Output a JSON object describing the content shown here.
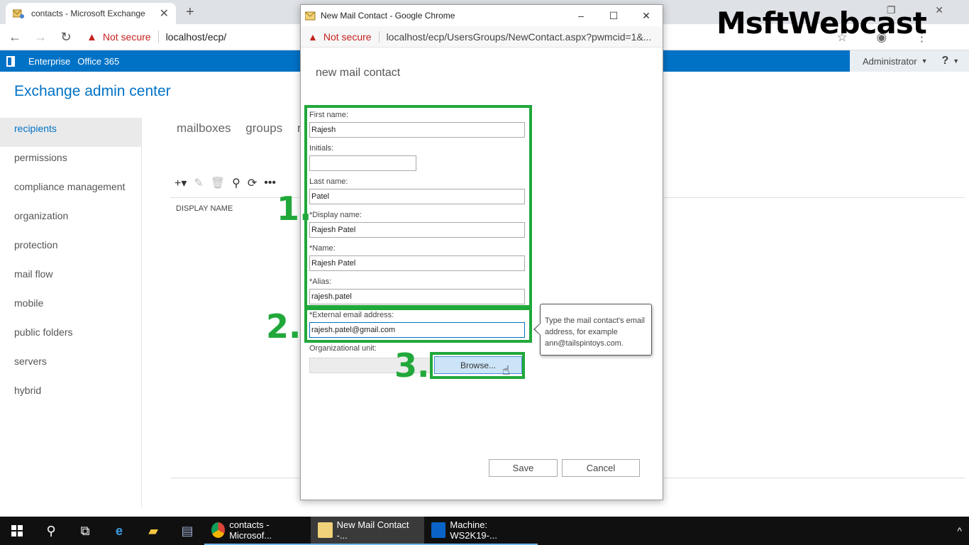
{
  "browser": {
    "tab_title": "contacts - Microsoft Exchange",
    "tab_close": "✕",
    "new_tab": "+",
    "win_controls": "–  ❐  ✕",
    "nav_back": "←",
    "nav_forward": "→",
    "nav_reload": "↻",
    "not_secure": "Not secure",
    "url": "localhost/ecp/",
    "right_icons": "☆ ◉ ⋮"
  },
  "eac": {
    "top_links": [
      "Enterprise",
      "Office 365"
    ],
    "admin": "Administrator",
    "help": "?",
    "title": "Exchange admin center",
    "nav": [
      "recipients",
      "permissions",
      "compliance management",
      "organization",
      "protection",
      "mail flow",
      "mobile",
      "public folders",
      "servers",
      "hybrid"
    ],
    "subtabs": [
      "mailboxes",
      "groups",
      "re"
    ],
    "toolbar": {
      "add": "+▾",
      "edit": "✎",
      "delete": "🗑",
      "search": "⚲",
      "refresh": "⟳",
      "more": "•••"
    },
    "column_header": "DISPLAY NAME"
  },
  "popup": {
    "window_title": "New Mail Contact - Google Chrome",
    "controls": {
      "minimize": "–",
      "maximize": "☐",
      "close": "✕"
    },
    "not_secure": "Not secure",
    "url": "localhost/ecp/UsersGroups/NewContact.aspx?pwmcid=1&...",
    "form_title": "new mail contact",
    "fields": {
      "first_name": {
        "label": "First name:",
        "value": "Rajesh"
      },
      "initials": {
        "label": "Initials:",
        "value": ""
      },
      "last_name": {
        "label": "Last name:",
        "value": "Patel"
      },
      "display_name": {
        "label": "*Display name:",
        "value": "Rajesh Patel"
      },
      "name": {
        "label": "*Name:",
        "value": "Rajesh Patel"
      },
      "alias": {
        "label": "*Alias:",
        "value": "rajesh.patel"
      },
      "external_email": {
        "label": "*External email address:",
        "value": "rajesh.patel@gmail.com"
      },
      "org_unit": {
        "label": "Organizational unit:",
        "value": ""
      }
    },
    "browse_label": "Browse...",
    "save_label": "Save",
    "cancel_label": "Cancel",
    "tooltip": "Type the mail contact's email address, for example ann@tailspintoys.com."
  },
  "annotations": {
    "step1": "1.",
    "step2": "2.",
    "step3": "3."
  },
  "watermark": "MsftWebcast",
  "taskbar": {
    "chrome_task": "contacts - Microsof...",
    "popup_task": "New Mail Contact -...",
    "machine_task": "Machine: WS2K19-...",
    "tray_chevron": "^"
  },
  "colors": {
    "eac_blue": "#0072c6",
    "annotation_green": "#21a83b",
    "taskbar": "#101010"
  }
}
